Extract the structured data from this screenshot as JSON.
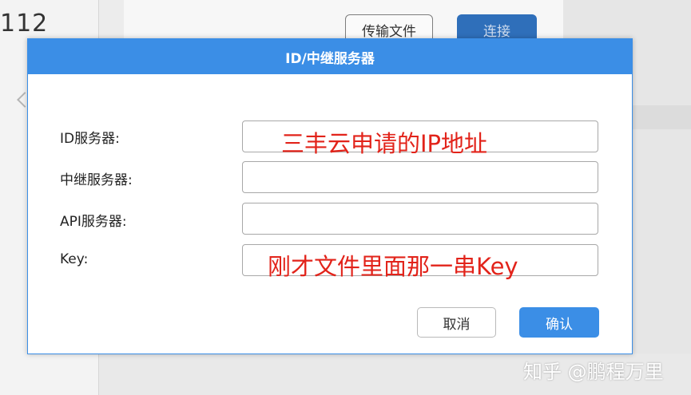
{
  "background": {
    "left_number": "112",
    "transfer_button": "传输文件",
    "connect_button": "连接"
  },
  "dialog": {
    "title": "ID/中继服务器",
    "fields": [
      {
        "label": "ID服务器:",
        "value": ""
      },
      {
        "label": "中继服务器:",
        "value": ""
      },
      {
        "label": "API服务器:",
        "value": ""
      },
      {
        "label": "Key:",
        "value": ""
      }
    ],
    "annotations": {
      "id_server": "三丰云申请的IP地址",
      "key": "刚才文件里面那一串Key"
    },
    "cancel_label": "取消",
    "confirm_label": "确认"
  },
  "watermark": "知乎 @鹏程万里",
  "colors": {
    "accent": "#3b8ee6",
    "annotation": "#e2231a"
  }
}
